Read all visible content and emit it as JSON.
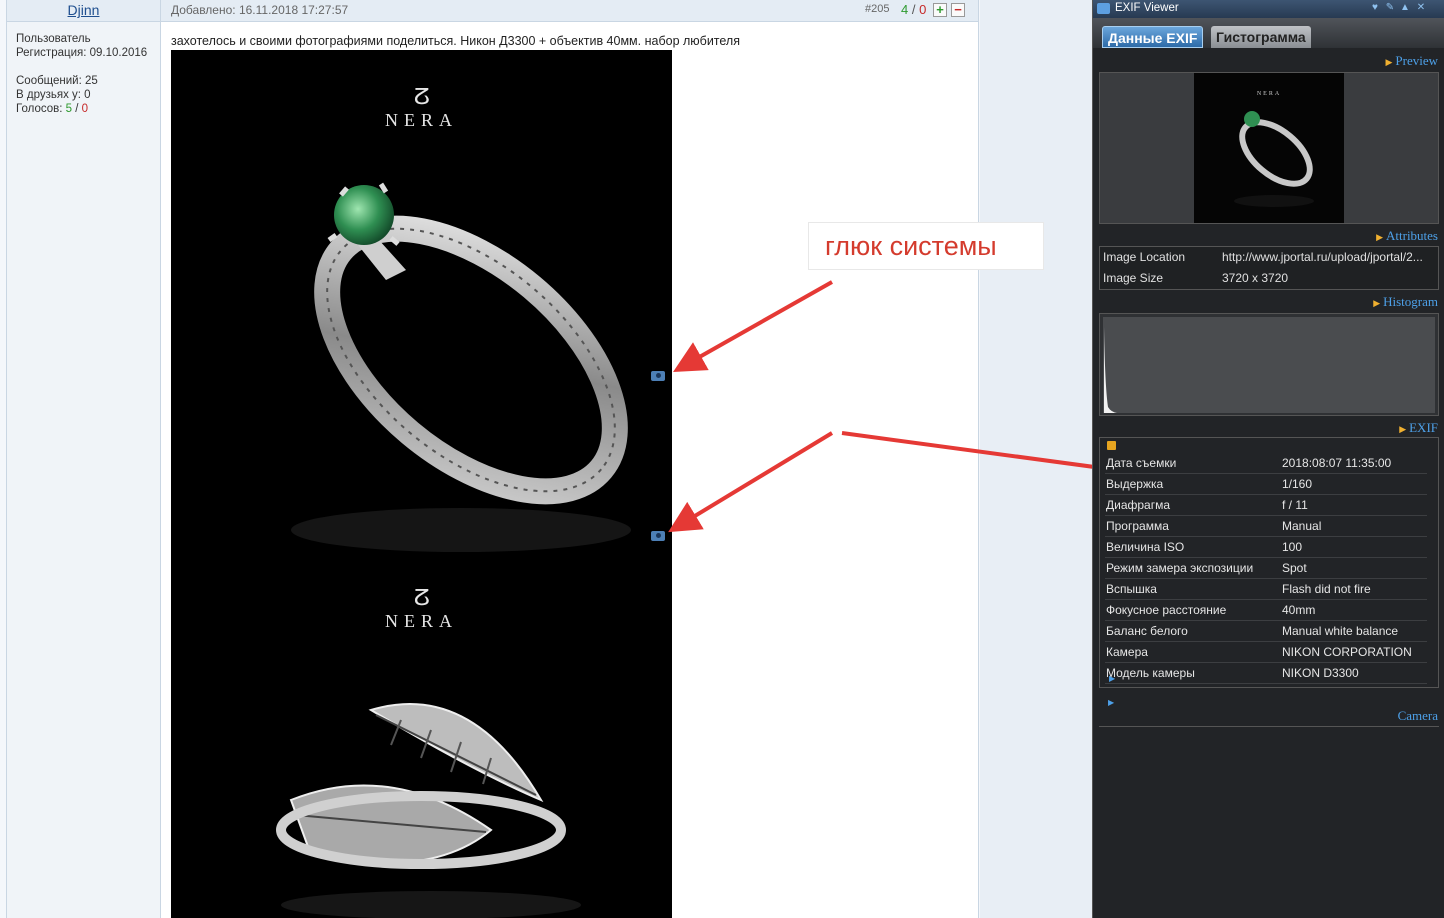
{
  "author": {
    "name": "Djinn",
    "role": "Пользователь",
    "registration": "Регистрация: 09.10.2016",
    "messages": "Сообщений: 25",
    "friends": "В друзьях у: 0",
    "votes_label": "Голосов:",
    "votes_positive": "5",
    "votes_separator": "/",
    "votes_negative": "0"
  },
  "post": {
    "date": "Добавлено: 16.11.2018 17:27:57",
    "number": "#205",
    "votes_positive": "4",
    "votes_separator": "/",
    "votes_negative": "0",
    "plus_symbol": "+",
    "minus_symbol": "−",
    "text": "захотелось и своими фотографиями поделиться. Никон Д3300 + объектив 40мм. набор любителя",
    "photo_logo_mark": "ⵒ",
    "photo_logo_word": "NERA"
  },
  "annotation": {
    "text": "глюк системы",
    "color": "#d43b2d"
  },
  "exif_viewer": {
    "title": "EXIF Viewer",
    "tabs": [
      {
        "label": "Данные EXIF",
        "active": true
      },
      {
        "label": "Гистограмма",
        "active": false
      }
    ],
    "preview_label": "Preview",
    "preview_logo": "NERA",
    "attributes_label": "Attributes",
    "attributes": [
      {
        "key": "Image Location",
        "value": "http://www.jportal.ru/upload/jportal/2..."
      },
      {
        "key": "Image Size",
        "value": "3720 x 3720"
      }
    ],
    "histogram_label": "Histogram",
    "exif_label": "EXIF",
    "exif_rows": [
      {
        "key": "Дата съемки",
        "value": "2018:08:07 11:35:00"
      },
      {
        "key": "Выдержка",
        "value": "1/160"
      },
      {
        "key": "Диафрагма",
        "value": "f / 11"
      },
      {
        "key": "Программа",
        "value": "Manual"
      },
      {
        "key": "Величина ISO",
        "value": "100"
      },
      {
        "key": "Режим замера экспозиции",
        "value": "Spot"
      },
      {
        "key": "Вспышка",
        "value": "Flash did not fire"
      },
      {
        "key": "Фокусное расстояние",
        "value": "40mm"
      },
      {
        "key": "Баланс белого",
        "value": "Manual white balance"
      },
      {
        "key": "Камера",
        "value": "NIKON CORPORATION"
      },
      {
        "key": "Модель камеры",
        "value": "NIKON D3300"
      }
    ],
    "camera_label": "Camera",
    "icons": [
      "camera-icon",
      "heart-icon",
      "wrench-icon",
      "warning-icon",
      "close-icon"
    ]
  }
}
